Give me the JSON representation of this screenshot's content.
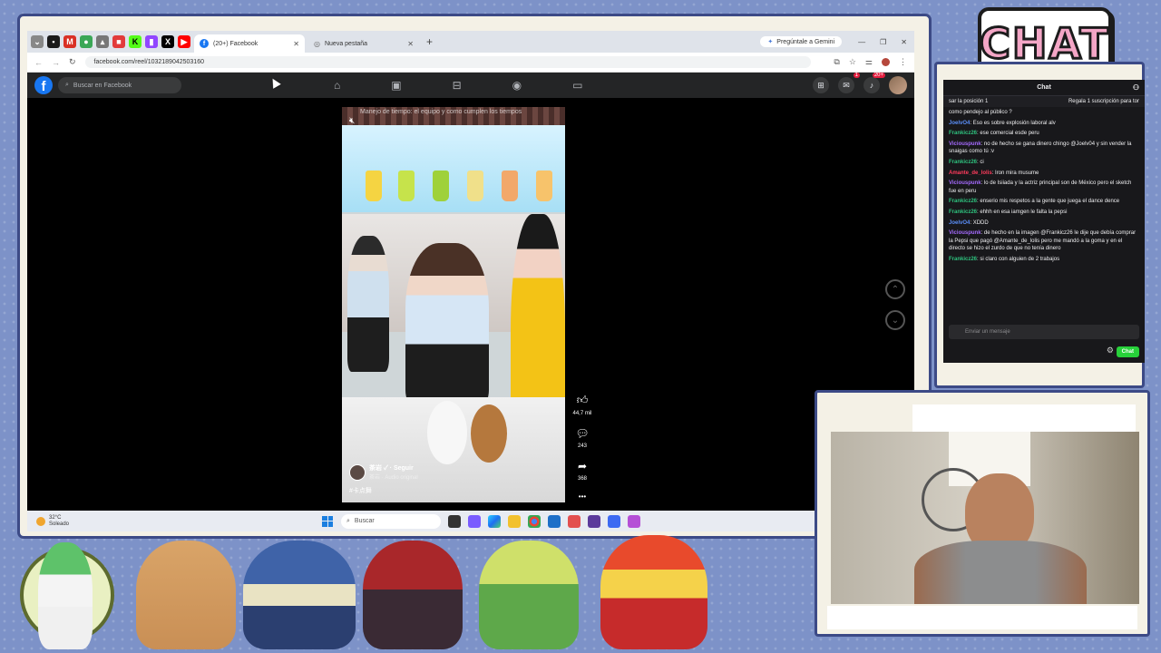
{
  "browser": {
    "tabs": [
      {
        "label": "(20+) Facebook",
        "active": true,
        "icon": "facebook-icon"
      },
      {
        "label": "Nueva pestaña",
        "active": false,
        "icon": "chrome-icon"
      }
    ],
    "new_tab_symbol": "+",
    "gemini_label": "Pregúntale a Gemini",
    "url": "facebook.com/reel/1032189042503160"
  },
  "facebook": {
    "search_placeholder": "Buscar en Facebook",
    "notification_badge": "20+",
    "reel": {
      "top_text": "Manejo de tiempo: el equipo y como cumplen los tiempos",
      "username": "茶岩 ✓ · Seguir",
      "audio": "茶岩 · Audio original",
      "tag": "#卡点舞"
    },
    "actions": [
      {
        "icon": "like-icon",
        "count": "44,7 mil"
      },
      {
        "icon": "comment-icon",
        "count": "243"
      },
      {
        "icon": "share-icon",
        "count": "368"
      }
    ],
    "more_symbol": "•••"
  },
  "taskbar": {
    "weather_temp": "32°C",
    "weather_desc": "Soleado",
    "search_placeholder": "Buscar"
  },
  "chat": {
    "logo_text": "CHAT",
    "header": "Chat",
    "pinned_left": "sar la posición 1",
    "pinned_right": "Regala 1 suscripción para tor",
    "messages": [
      {
        "user": "",
        "text": "como pendejo al público ?",
        "color": "#efeff1"
      },
      {
        "user": "JoelvO4",
        "text": ": Eso es sobre explosión laboral alv",
        "color": "#5b8ff9"
      },
      {
        "user": "Frankicz26",
        "text": ": ese comercial esde peru",
        "color": "#2ec27e"
      },
      {
        "user": "Viciouspunk",
        "text": ": no de hecho se gana dinero chingo @Joelv04 y sin vender la snaigas como tú :v",
        "color": "#a66bff"
      },
      {
        "user": "Frankicz26",
        "text": ": ci",
        "color": "#2ec27e"
      },
      {
        "user": "Amante_de_lolis",
        "text": ": Iron mira musume",
        "color": "#ff3b5c"
      },
      {
        "user": "Viciouspunk",
        "text": ": lo de Isiiada y la actriz principal son de México pero el sketch fue en peru",
        "color": "#a66bff"
      },
      {
        "user": "Frankicz26",
        "text": ": enserio mis respetos a la gente que juega el dance dence",
        "color": "#2ec27e"
      },
      {
        "user": "Frankicz26",
        "text": ": ehhh en esa iamgen le falta la pepsi",
        "color": "#2ec27e"
      },
      {
        "user": "JoelvO4",
        "text": ": XDDD",
        "color": "#5b8ff9"
      },
      {
        "user": "Viciouspunk",
        "text": ": de hecho en la imagen @Frankicz26 le dije que debía comprar la Pepsi que pagó @Amante_de_lolis pero me mandó a la goma y en el directo se hizo el zurdo de que no tenía dinero",
        "color": "#a66bff"
      },
      {
        "user": "Frankicz26",
        "text": ": si claro con alguien de 2 trabajos",
        "color": "#2ec27e"
      }
    ],
    "input_placeholder": "Enviar un mensaje",
    "send_button": "Chat"
  },
  "accent_colors": {
    "facebook_blue": "#1877f2",
    "twitch_green": "#27d13a",
    "frame_navy": "#3c4a86",
    "background": "#7d92c8"
  }
}
